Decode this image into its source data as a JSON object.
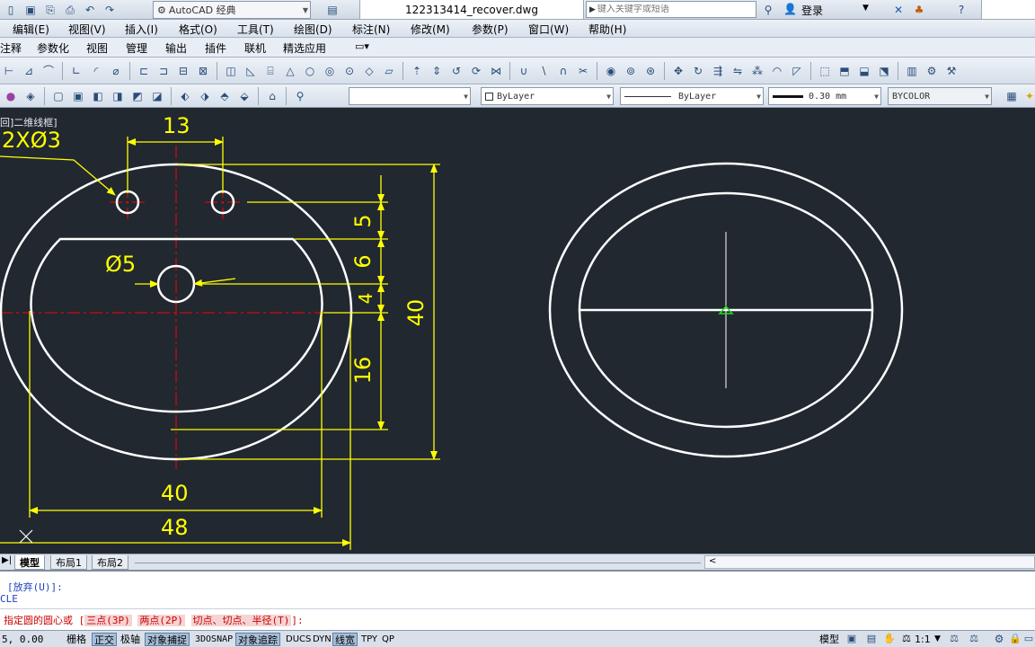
{
  "titlebar": {
    "workspace": "AutoCAD 经典",
    "filename": "122313414_recover.dwg",
    "search_placeholder": "键入关键字或短语",
    "login": "登录"
  },
  "menubar": {
    "items": [
      "编辑(E)",
      "视图(V)",
      "插入(I)",
      "格式(O)",
      "工具(T)",
      "绘图(D)",
      "标注(N)",
      "修改(M)",
      "参数(P)",
      "窗口(W)",
      "帮助(H)"
    ]
  },
  "ribbon_tabs": {
    "items": [
      "注释",
      "参数化",
      "视图",
      "管理",
      "输出",
      "插件",
      "联机",
      "精选应用"
    ]
  },
  "properties": {
    "color": "ByLayer",
    "linetype": "ByLayer",
    "lineweight": "0.30 mm",
    "plotstyle": "BYCOLOR"
  },
  "viewport": {
    "label": "[俯视][二维线框]",
    "label_visible": "回]二维线框]"
  },
  "drawing": {
    "dims": {
      "hole_spacing": "13",
      "hole_callout": "2XØ3",
      "center_hole": "Ø5",
      "v5": "5",
      "v6": "6",
      "v4": "4",
      "v16": "16",
      "v40_overall": "40",
      "h40": "40",
      "h48": "48"
    }
  },
  "layout_tabs": {
    "items": [
      "模型",
      "布局1",
      "布局2"
    ],
    "active": "模型"
  },
  "command": {
    "line1": "[放弃(U)]:",
    "line2": "CLE",
    "prompt_prefix": "指定圆的圆心或",
    "opt1": "三点(3P)",
    "opt2": "两点(2P)",
    "opt3": "切点、切点、半径(T)",
    "prompt_suffix": "]:"
  },
  "status": {
    "coords": "5, 0.00",
    "toggles": [
      "栅格",
      "正交",
      "极轴",
      "对象捕捉",
      "3DOSNAP",
      "对象追踪",
      "DUCS",
      "DYN",
      "线宽",
      "TPY",
      "QP"
    ],
    "model_label": "模型",
    "scale": "1:1"
  },
  "colors": {
    "canvas_bg": "#212830",
    "geometry": "#ffffff",
    "dimension": "#ffff00",
    "centerline": "#ff0000",
    "command_red": "#cc0000",
    "command_blue": "#1f3fbf"
  }
}
